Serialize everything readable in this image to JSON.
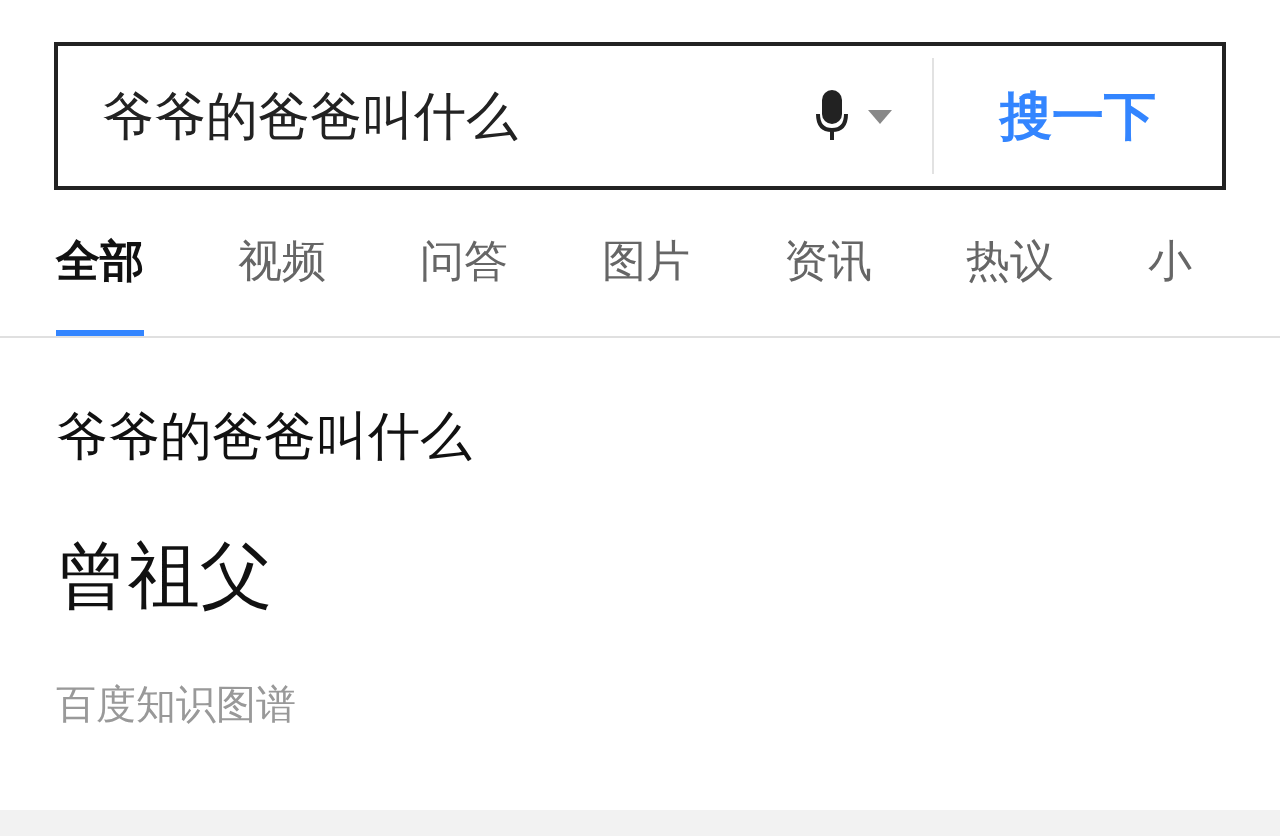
{
  "search": {
    "value": "爷爷的爸爸叫什么",
    "button": "搜一下"
  },
  "tabs": [
    {
      "label": "全部",
      "selected": true
    },
    {
      "label": "视频",
      "selected": false
    },
    {
      "label": "问答",
      "selected": false
    },
    {
      "label": "图片",
      "selected": false
    },
    {
      "label": "资讯",
      "selected": false
    },
    {
      "label": "热议",
      "selected": false
    },
    {
      "label": "小",
      "selected": false
    }
  ],
  "result": {
    "question": "爷爷的爸爸叫什么",
    "answer": "曾祖父",
    "source": "百度知识图谱"
  }
}
